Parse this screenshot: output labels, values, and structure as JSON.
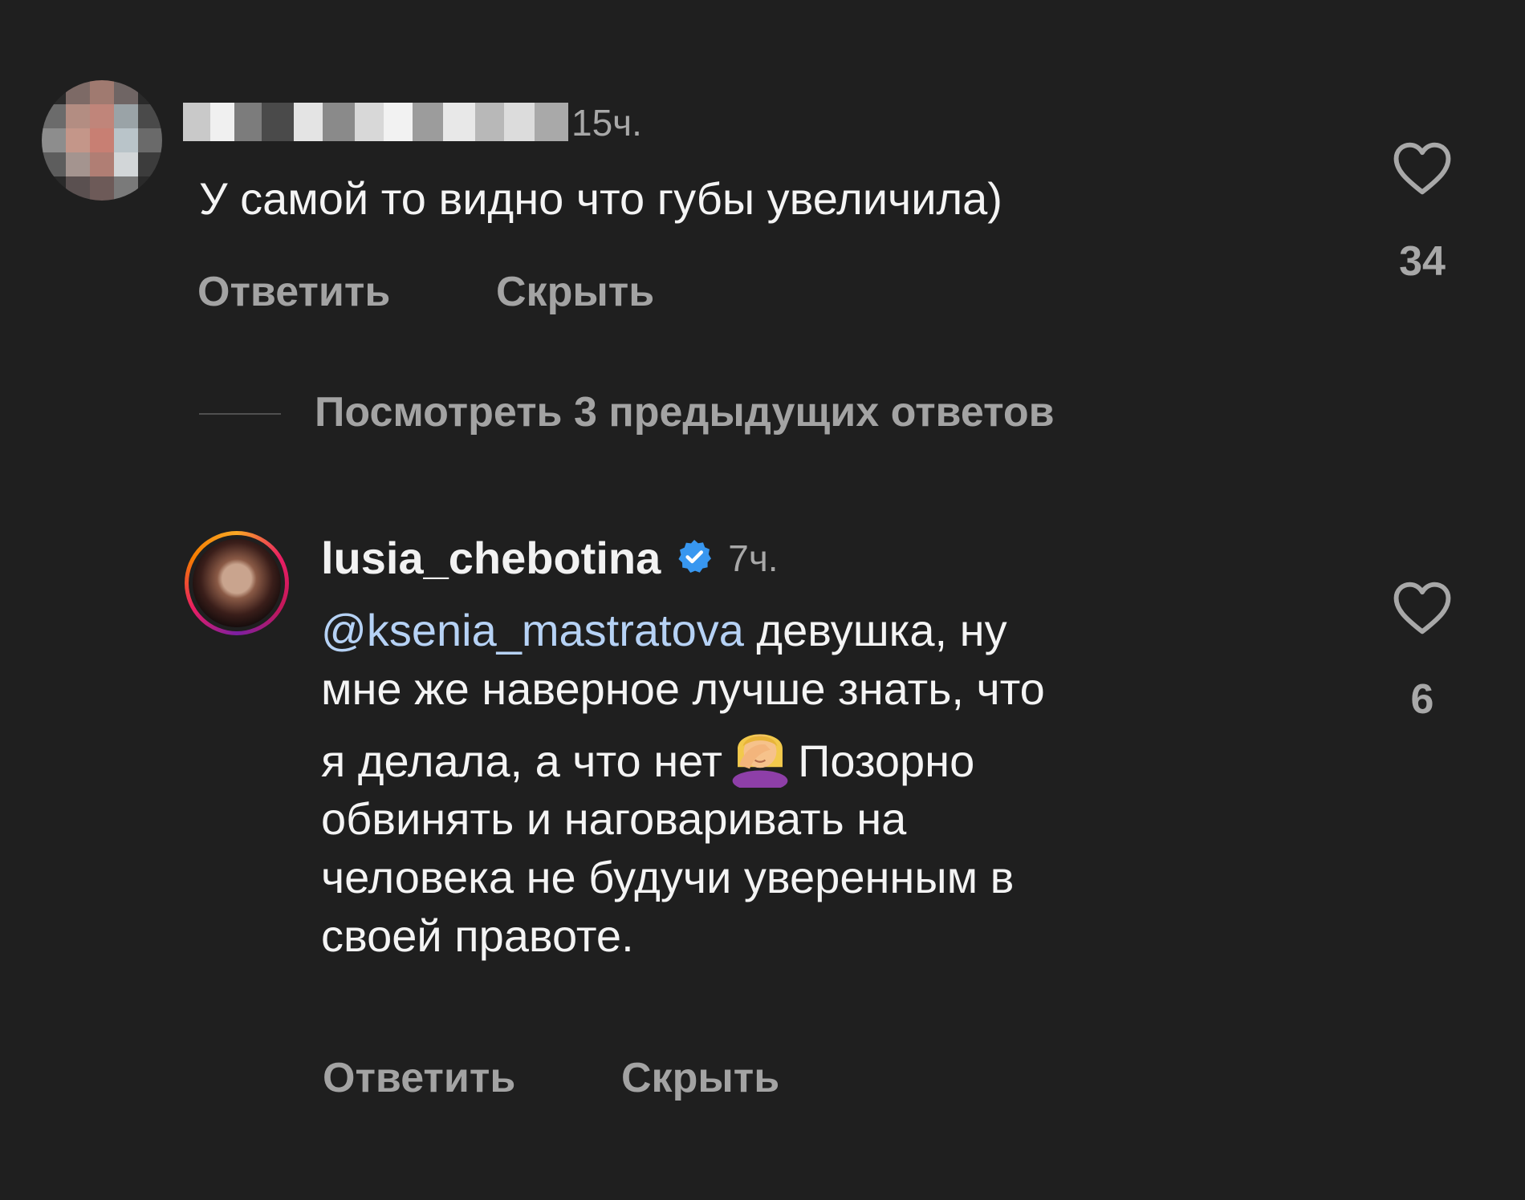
{
  "comment1": {
    "time": "15ч.",
    "text": "У самой то видно что губы увеличила)",
    "reply_label": "Ответить",
    "hide_label": "Скрыть",
    "likes": "34"
  },
  "view_replies": "Посмотреть 3 предыдущих ответов",
  "comment2": {
    "username": "lusia_chebotina",
    "time": "7ч.",
    "mention": "@ksenia_mastratova",
    "text_line1": " девушка, ну",
    "text_line2": "мне же наверное лучше знать, что",
    "text_line3a": "я делала, а что нет",
    "text_line3b": "Позорно",
    "text_line4": "обвинять и наговаривать на",
    "text_line5": "человека не будучи уверенным в",
    "text_line6": "своей правоте.",
    "reply_label": "Ответить",
    "hide_label": "Скрыть",
    "likes": "6"
  },
  "colors": {
    "background": "#1f1f1f",
    "mention": "#b6d2f5",
    "verified": "#3897f0",
    "secondary_text": "#a3a3a3"
  },
  "icons": [
    "heart-icon",
    "verified-badge-icon",
    "facepalm-emoji"
  ]
}
